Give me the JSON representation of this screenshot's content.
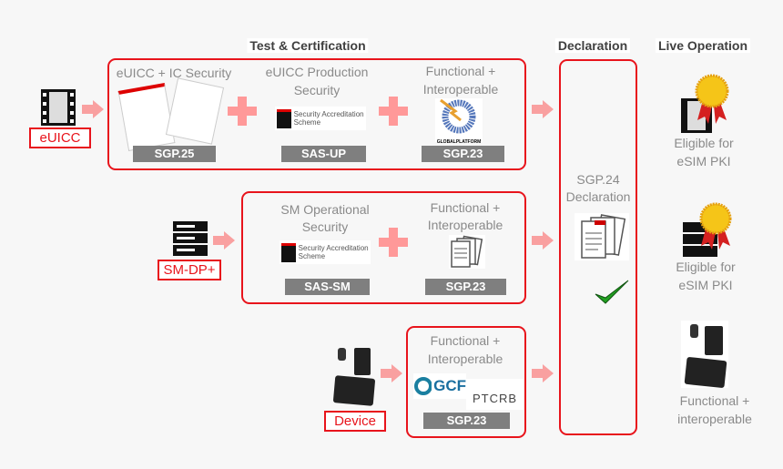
{
  "headings": {
    "test": "Test & Certification",
    "declaration": "Declaration",
    "live": "Live Operation"
  },
  "entities": {
    "euicc": "eUICC",
    "smdp": "SM-DP+",
    "device": "Device"
  },
  "row1": {
    "c1_title": "eUICC + IC Security",
    "c1_label": "SGP.25",
    "c2_title_1": "eUICC Production",
    "c2_title_2": "Security",
    "c2_label": "SAS-UP",
    "c3_title_1": "Functional +",
    "c3_title_2": "Interoperable",
    "c3_label": "SGP.23",
    "sas_logo": "Security Accreditation Scheme",
    "gp_logo": "GLOBALPLATFORM"
  },
  "row2": {
    "c1_title_1": "SM Operational",
    "c1_title_2": "Security",
    "c1_label": "SAS-SM",
    "c2_title_1": "Functional +",
    "c2_title_2": "Interoperable",
    "c2_label": "SGP.23",
    "sas_logo": "Security Accreditation Scheme"
  },
  "row3": {
    "title_1": "Functional +",
    "title_2": "Interoperable",
    "label": "SGP.23",
    "gcf_logo": "GCF",
    "ptcrb_logo": "PTCRB"
  },
  "decl": {
    "line1": "SGP.24",
    "line2": "Declaration"
  },
  "live": [
    {
      "l1": "Eligible for",
      "l2": "eSIM PKI"
    },
    {
      "l1": "Eligible for",
      "l2": "eSIM PKI"
    },
    {
      "l1": "Functional +",
      "l2": "interoperable"
    }
  ],
  "colors": {
    "accent": "#e8141c",
    "arrow": "#f9a0a0",
    "label_bg": "#7f7f7f"
  }
}
